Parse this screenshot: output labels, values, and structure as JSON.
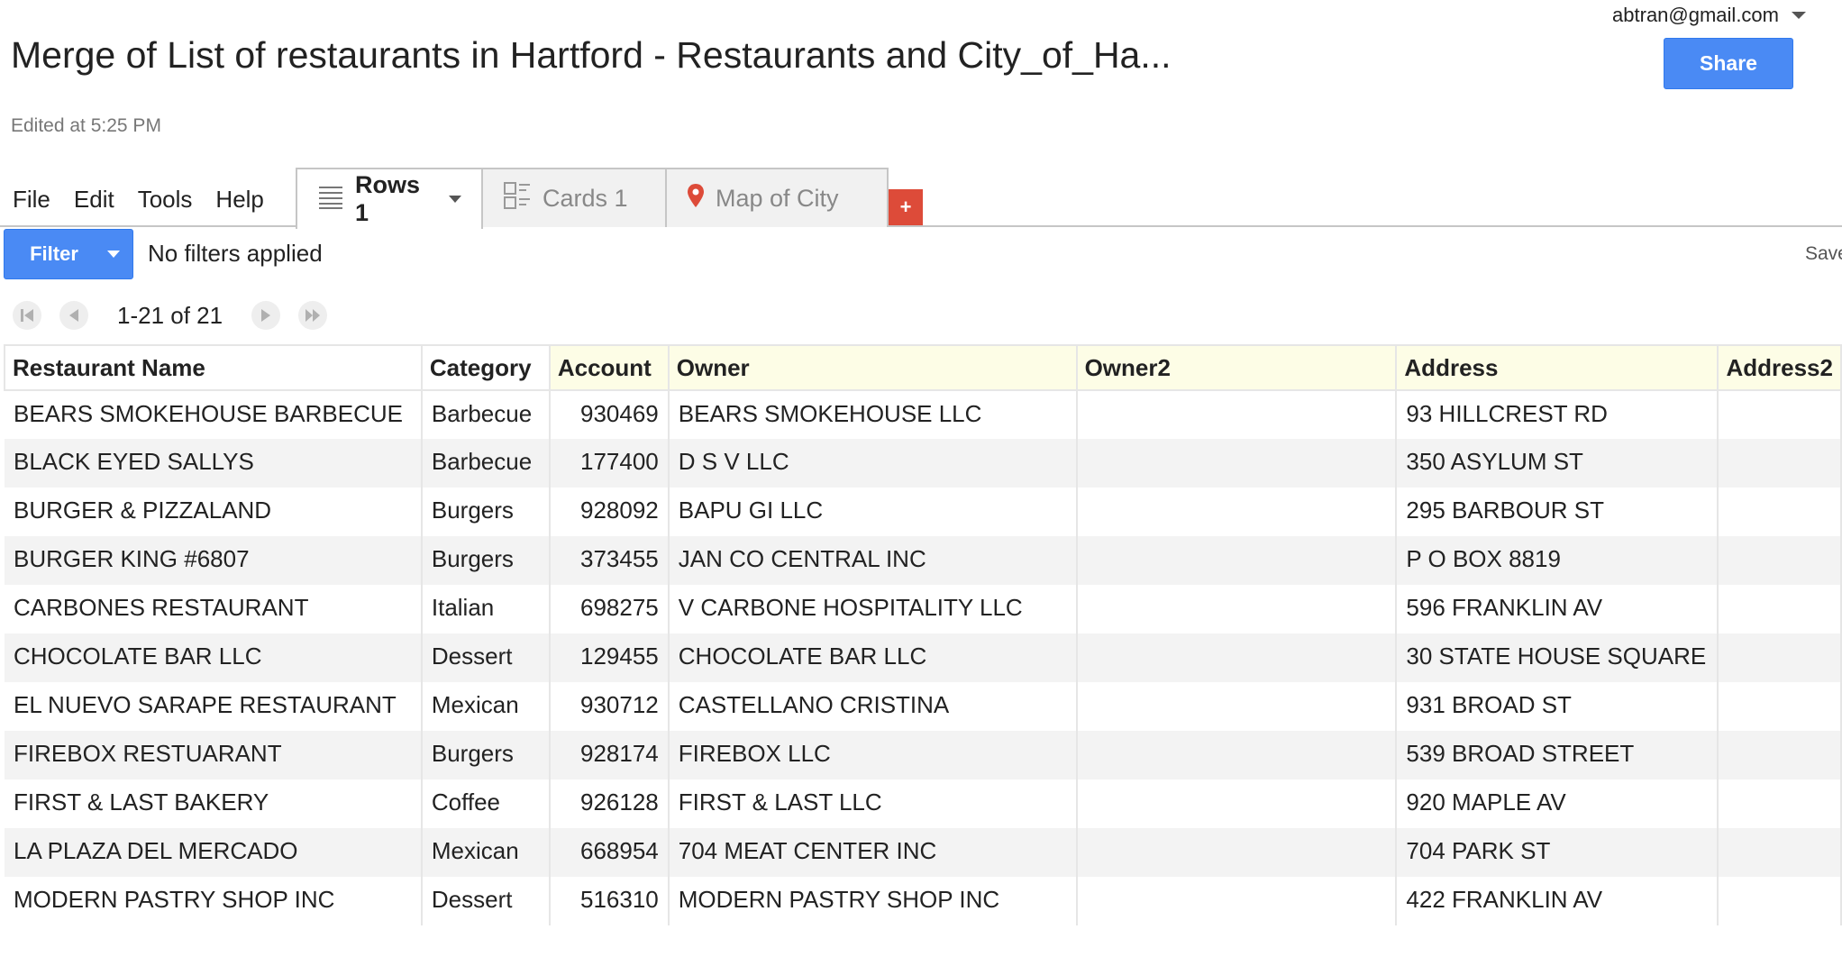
{
  "header": {
    "account_email": "abtran@gmail.com",
    "title": "Merge of List of restaurants in Hartford - Restaurants and City_of_Ha...",
    "share_label": "Share",
    "edited": "Edited at 5:25 PM"
  },
  "menu": {
    "file": "File",
    "edit": "Edit",
    "tools": "Tools",
    "help": "Help"
  },
  "tabs": {
    "rows": "Rows 1",
    "cards": "Cards 1",
    "map": "Map of City",
    "add": "+"
  },
  "filter": {
    "button_label": "Filter",
    "status": "No filters applied",
    "save_label": "Save"
  },
  "pager": {
    "range": "1-21 of 21"
  },
  "table": {
    "columns": [
      "Restaurant Name",
      "Category",
      "Account",
      "Owner",
      "Owner2",
      "Address",
      "Address2"
    ],
    "rows": [
      [
        "BEARS SMOKEHOUSE BARBECUE",
        "Barbecue",
        "930469",
        "BEARS SMOKEHOUSE LLC",
        "",
        "93 HILLCREST RD",
        ""
      ],
      [
        "BLACK EYED SALLYS",
        "Barbecue",
        "177400",
        "D S V LLC",
        "",
        "350 ASYLUM ST",
        ""
      ],
      [
        "BURGER & PIZZALAND",
        "Burgers",
        "928092",
        "BAPU GI LLC",
        "",
        "295 BARBOUR ST",
        ""
      ],
      [
        "BURGER KING #6807",
        "Burgers",
        "373455",
        "JAN CO CENTRAL INC",
        "",
        "P O BOX 8819",
        ""
      ],
      [
        "CARBONES RESTAURANT",
        "Italian",
        "698275",
        "V CARBONE HOSPITALITY LLC",
        "",
        "596 FRANKLIN AV",
        ""
      ],
      [
        "CHOCOLATE BAR LLC",
        "Dessert",
        "129455",
        "CHOCOLATE BAR LLC",
        "",
        "30 STATE HOUSE SQUARE",
        ""
      ],
      [
        "EL NUEVO SARAPE RESTAURANT",
        "Mexican",
        "930712",
        "CASTELLANO CRISTINA",
        "",
        "931 BROAD ST",
        ""
      ],
      [
        "FIREBOX RESTUARANT",
        "Burgers",
        "928174",
        "FIREBOX LLC",
        "",
        "539 BROAD STREET",
        ""
      ],
      [
        "FIRST & LAST BAKERY",
        "Coffee",
        "926128",
        "FIRST & LAST LLC",
        "",
        "920 MAPLE AV",
        ""
      ],
      [
        "LA PLAZA DEL MERCADO",
        "Mexican",
        "668954",
        "704 MEAT CENTER INC",
        "",
        "704 PARK ST",
        ""
      ],
      [
        "MODERN PASTRY SHOP INC",
        "Dessert",
        "516310",
        "MODERN PASTRY SHOP INC",
        "",
        "422 FRANKLIN AV",
        ""
      ]
    ]
  },
  "colors": {
    "primary_blue": "#4a8af4",
    "add_tab_red": "#dd4b39",
    "header_cell_bg": "#fdfde6",
    "map_pin": "#dd4b39"
  },
  "icons": {
    "rows_tab": "list-lines-icon",
    "cards_tab": "cards-icon",
    "map_tab": "map-pin-icon",
    "pager": [
      "first-page-icon",
      "prev-page-icon",
      "next-page-icon",
      "last-page-icon"
    ]
  }
}
